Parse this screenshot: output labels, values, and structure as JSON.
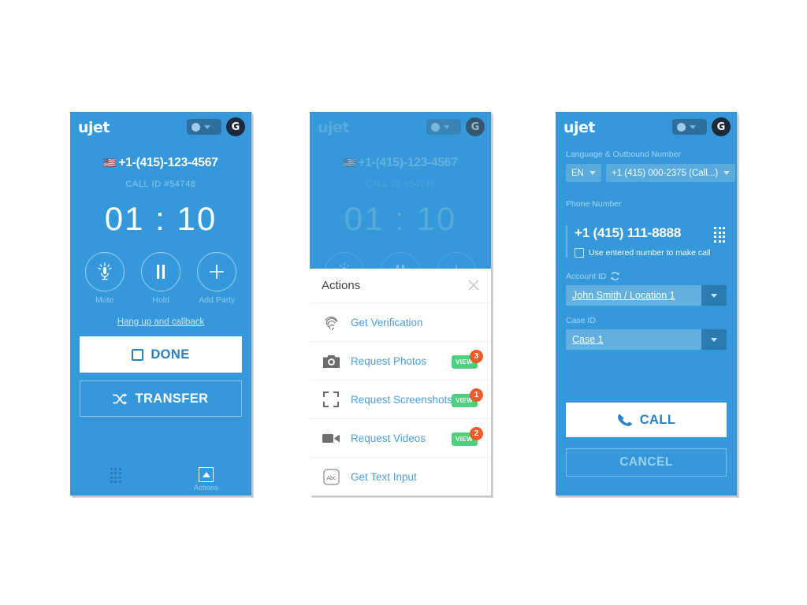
{
  "brand": {
    "logo": "ujet",
    "accent": "#3498db",
    "avatar_initial": "G"
  },
  "call_panel": {
    "phone_number": "+1-(415)-123-4567",
    "flag": "🇺🇸",
    "call_id": "CALL ID #54748",
    "timer": "01 : 10",
    "controls": [
      {
        "label": "Mute",
        "icon": "microphone-icon"
      },
      {
        "label": "Hold",
        "icon": "pause-icon"
      },
      {
        "label": "Add Party",
        "icon": "plus-icon"
      }
    ],
    "hangup_link": "Hang up and callback",
    "done_label": "DONE",
    "transfer_label": "TRANSFER",
    "tabs": [
      {
        "label": "",
        "icon": "dialpad-icon"
      },
      {
        "label": "Actions",
        "icon": "actions-icon"
      }
    ]
  },
  "actions_sheet": {
    "title": "Actions",
    "close_icon": "close-icon",
    "items": [
      {
        "label": "Get Verification",
        "icon": "fingerprint-icon",
        "badge": null,
        "count": null
      },
      {
        "label": "Request Photos",
        "icon": "camera-icon",
        "badge": "VIEW",
        "count": "3"
      },
      {
        "label": "Request Screenshots",
        "icon": "crop-icon",
        "badge": "VIEW",
        "count": "1"
      },
      {
        "label": "Request Videos",
        "icon": "video-icon",
        "badge": "VIEW",
        "count": "2"
      },
      {
        "label": "Get Text Input",
        "icon": "abc-icon",
        "badge": null,
        "count": null
      }
    ],
    "badge_color": "#4cd07d",
    "count_color": "#f15a29"
  },
  "dialer_panel": {
    "language_label": "Language & Outbound Number",
    "language_value": "EN",
    "outbound_value": "+1 (415) 000-2375 (Call...)",
    "phone_label": "Phone Number",
    "phone_value": "+1 (415) 111-8888",
    "keypad_icon": "dialpad-icon",
    "checkbox_label": "Use entered number to make call",
    "account_label": "Account ID",
    "account_refresh_icon": "refresh-icon",
    "account_value": "John Smith / Location 1",
    "case_label": "Case ID",
    "case_value": "Case 1",
    "call_label": "CALL",
    "cancel_label": "CANCEL"
  }
}
